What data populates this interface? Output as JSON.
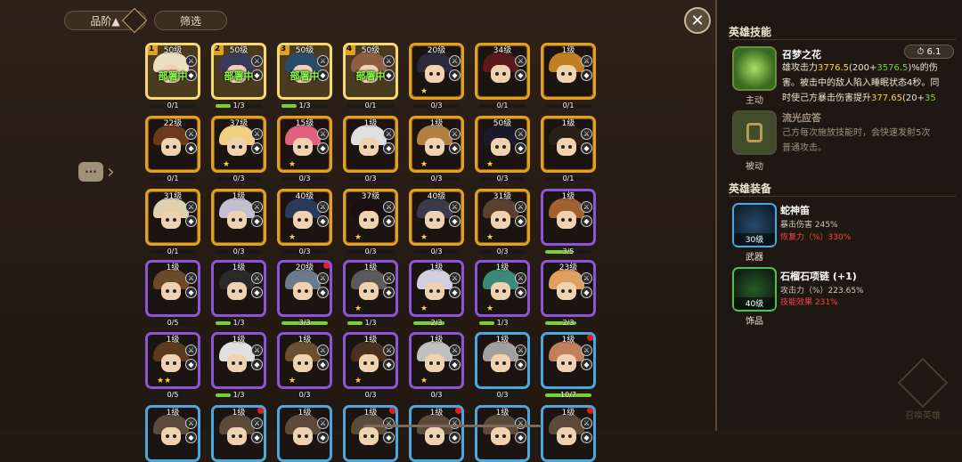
{
  "toolbar": {
    "grade_label": "品阶▲",
    "filter_label": "筛选",
    "close_label": "✕",
    "side_label": "···"
  },
  "heroes": [
    [
      {
        "level": "50级",
        "frame": "sel",
        "deployed": true,
        "slot": "1",
        "progress": "0/1",
        "fill": 0,
        "stars": "",
        "hair": "#e8e0c0"
      },
      {
        "level": "50级",
        "frame": "sel",
        "deployed": true,
        "slot": "2",
        "progress": "1/3",
        "fill": 0.33,
        "stars": "",
        "hair": "#3a3a5a"
      },
      {
        "level": "50级",
        "frame": "sel",
        "deployed": true,
        "slot": "3",
        "progress": "1/3",
        "fill": 0.33,
        "stars": "",
        "hair": "#2a4a6a"
      },
      {
        "level": "50级",
        "frame": "sel",
        "deployed": true,
        "slot": "4",
        "progress": "0/1",
        "fill": 0,
        "stars": "",
        "hair": "#8a6040"
      },
      {
        "level": "20级",
        "frame": "gold",
        "progress": "0/3",
        "fill": 0,
        "stars": "★",
        "hair": "#2a2a3a"
      },
      {
        "level": "34级",
        "frame": "gold",
        "progress": "0/1",
        "fill": 0,
        "stars": "",
        "hair": "#5a1a1a"
      },
      {
        "level": "1级",
        "frame": "gold",
        "progress": "0/1",
        "fill": 0,
        "stars": "",
        "hair": "#c08020"
      }
    ],
    [
      {
        "level": "22级",
        "frame": "gold",
        "progress": "0/1",
        "fill": 0,
        "stars": "",
        "hair": "#6a3a1a"
      },
      {
        "level": "37级",
        "frame": "gold",
        "progress": "0/3",
        "fill": 0,
        "stars": "★",
        "hair": "#f0d080"
      },
      {
        "level": "15级",
        "frame": "gold",
        "progress": "0/3",
        "fill": 0,
        "stars": "★",
        "hair": "#e06080"
      },
      {
        "level": "1级",
        "frame": "gold",
        "progress": "0/3",
        "fill": 0,
        "stars": "",
        "hair": "#e0e0e0"
      },
      {
        "level": "1级",
        "frame": "gold",
        "progress": "0/3",
        "fill": 0,
        "stars": "★",
        "hair": "#b08040"
      },
      {
        "level": "50级",
        "frame": "gold",
        "progress": "0/3",
        "fill": 0,
        "stars": "★",
        "hair": "#1a1a2a"
      },
      {
        "level": "1级",
        "frame": "gold",
        "progress": "0/1",
        "fill": 0,
        "stars": "",
        "hair": "#2a2018"
      }
    ],
    [
      {
        "level": "31级",
        "frame": "gold",
        "progress": "0/1",
        "fill": 0,
        "stars": "",
        "hair": "#e0d0b0"
      },
      {
        "level": "1级",
        "frame": "gold",
        "progress": "0/3",
        "fill": 0,
        "stars": "",
        "hair": "#c0c0d0"
      },
      {
        "level": "40级",
        "frame": "gold",
        "progress": "0/3",
        "fill": 0,
        "stars": "★",
        "hair": "#2a3a5a"
      },
      {
        "level": "37级",
        "frame": "gold",
        "progress": "0/3",
        "fill": 0,
        "stars": "★",
        "hair": "#1a1010"
      },
      {
        "level": "40级",
        "frame": "gold",
        "progress": "0/3",
        "fill": 0,
        "stars": "★",
        "hair": "#3a3a4a"
      },
      {
        "level": "31级",
        "frame": "gold",
        "progress": "0/3",
        "fill": 0,
        "stars": "★",
        "hair": "#5a4030"
      },
      {
        "level": "1级",
        "frame": "purple",
        "progress": "3/5",
        "fill": 0.6,
        "stars": "",
        "hair": "#a06030"
      }
    ],
    [
      {
        "level": "1级",
        "frame": "purple",
        "progress": "0/5",
        "fill": 0,
        "stars": "",
        "hair": "#6a4a2a"
      },
      {
        "level": "1级",
        "frame": "purple",
        "progress": "1/3",
        "fill": 0.33,
        "stars": "",
        "hair": "#2a2a2a"
      },
      {
        "level": "20级",
        "frame": "purple",
        "progress": "3/3",
        "fill": 1,
        "stars": "",
        "hair": "#6a7a8a",
        "reddot": true
      },
      {
        "level": "1级",
        "frame": "purple",
        "progress": "1/3",
        "fill": 0.33,
        "stars": "★",
        "hair": "#5a5a5a"
      },
      {
        "level": "1级",
        "frame": "purple",
        "progress": "2/3",
        "fill": 0.67,
        "stars": "★",
        "hair": "#d0d0e0"
      },
      {
        "level": "1级",
        "frame": "purple",
        "progress": "1/3",
        "fill": 0.33,
        "stars": "★",
        "hair": "#3a8a7a"
      },
      {
        "level": "23级",
        "frame": "purple",
        "progress": "2/3",
        "fill": 0.67,
        "stars": "",
        "hair": "#e0a060"
      }
    ],
    [
      {
        "level": "1级",
        "frame": "purple",
        "progress": "0/5",
        "fill": 0,
        "stars": "★★",
        "hair": "#5a3a20"
      },
      {
        "level": "1级",
        "frame": "purple",
        "progress": "1/3",
        "fill": 0.33,
        "stars": "",
        "hair": "#e0e0e0"
      },
      {
        "level": "1级",
        "frame": "purple",
        "progress": "0/3",
        "fill": 0,
        "stars": "★",
        "hair": "#6a5030"
      },
      {
        "level": "1级",
        "frame": "purple",
        "progress": "0/3",
        "fill": 0,
        "stars": "★",
        "hair": "#4a3020"
      },
      {
        "level": "1级",
        "frame": "purple",
        "progress": "0/3",
        "fill": 0,
        "stars": "★",
        "hair": "#c0c0c0"
      },
      {
        "level": "1级",
        "frame": "blue",
        "progress": "0/3",
        "fill": 0,
        "stars": "",
        "hair": "#a0a0a0"
      },
      {
        "level": "1级",
        "frame": "blue",
        "progress": "10/7",
        "fill": 1,
        "stars": "",
        "hair": "#c08060",
        "reddot": true
      }
    ],
    [
      {
        "level": "1级",
        "frame": "blue",
        "progress": "",
        "fill": 0,
        "stars": "",
        "hair": "#5a4a3a"
      },
      {
        "level": "1级",
        "frame": "blue",
        "progress": "",
        "fill": 0,
        "stars": "",
        "hair": "#5a4a3a",
        "reddot": true
      },
      {
        "level": "1级",
        "frame": "blue",
        "progress": "",
        "fill": 0,
        "stars": "",
        "hair": "#5a4a3a"
      },
      {
        "level": "1级",
        "frame": "blue",
        "progress": "",
        "fill": 0,
        "stars": "",
        "hair": "#5a4a3a",
        "reddot": true
      },
      {
        "level": "1级",
        "frame": "blue",
        "progress": "",
        "fill": 0,
        "stars": "",
        "hair": "#5a4a3a",
        "reddot": true
      },
      {
        "level": "1级",
        "frame": "blue",
        "progress": "",
        "fill": 0,
        "stars": "",
        "hair": "#5a4a3a"
      },
      {
        "level": "1级",
        "frame": "blue",
        "progress": "",
        "fill": 0,
        "stars": "",
        "hair": "#5a4a3a",
        "reddot": true
      }
    ]
  ],
  "deploy_text": "部署中",
  "panel": {
    "skills_header": "英雄技能",
    "skill1": {
      "name": "召梦之花",
      "cooldown": "6.1",
      "type": "主动",
      "desc_l1_a": "雄攻击力",
      "desc_l1_b": "3776.5",
      "desc_l1_c": "(200+",
      "desc_l1_d": "3576.5",
      "desc_l1_e": ")%的伤",
      "desc_l2": "害。被击中的敌人陷入睡眠状态4秒。同",
      "desc_l3_a": "时使己方暴击伤害提升",
      "desc_l3_b": "377.65",
      "desc_l3_c": "(20+",
      "desc_l3_d": "35"
    },
    "skill2": {
      "name": "流光应答",
      "type": "被动",
      "desc_l1": "己方每次施放技能时，会快速发射5次",
      "desc_l2": "普通攻击。"
    },
    "equip_header": "英雄装备",
    "equip1": {
      "name": "蛇神笛",
      "attr1": "暴击伤害 245%",
      "attr2": "恢复力（%）330%",
      "level": "30级",
      "slot": "武器"
    },
    "equip2": {
      "name": "石榴石项链 (+1)",
      "attr1": "攻击力（%）223.65%",
      "attr2": "技能效果 231%",
      "level": "40级",
      "slot": "饰品"
    },
    "summon_label": "召唤英雄"
  }
}
